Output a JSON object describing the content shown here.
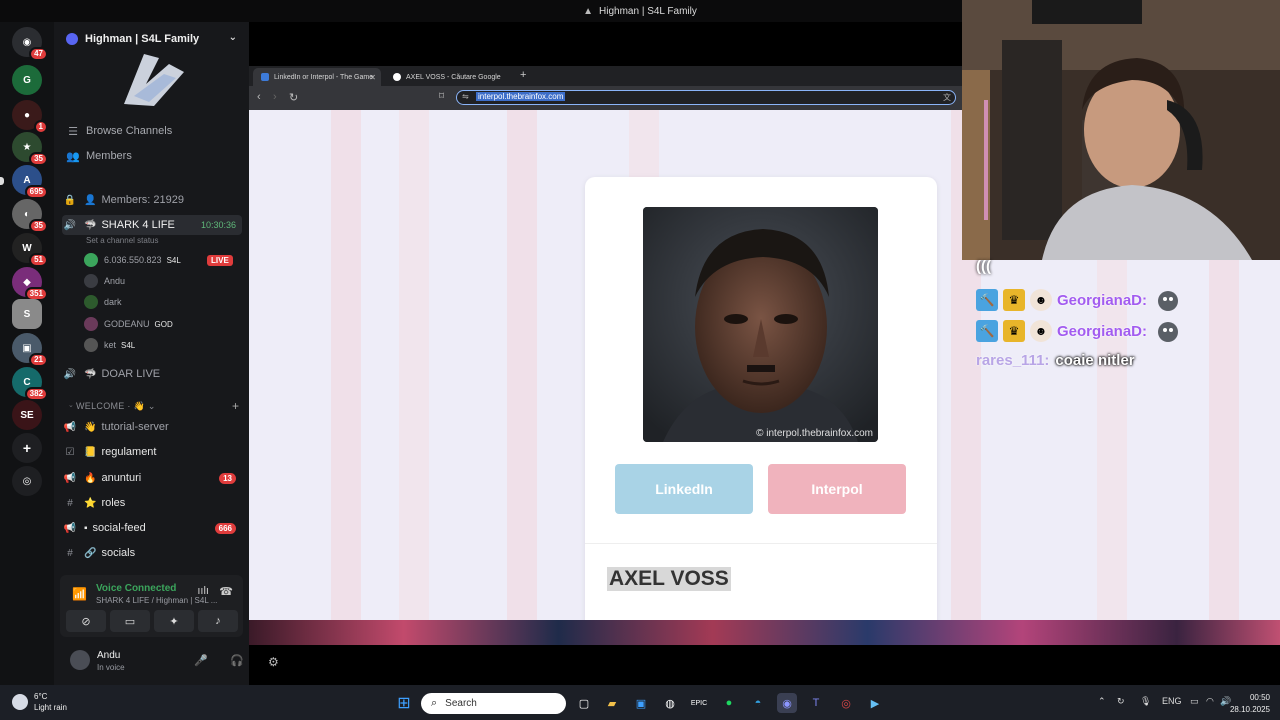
{
  "window": {
    "title": "Highman | S4L Family"
  },
  "discord": {
    "server_name": "Highman | S4L Family",
    "nav": [
      {
        "label": "Browse Channels",
        "icon": "list-icon"
      },
      {
        "label": "Members",
        "icon": "people-icon"
      }
    ],
    "members_channel": "Members: 21929",
    "active_voice": {
      "name": "SHARK 4 LIFE",
      "time": "10:30:36",
      "status": "Set a channel status"
    },
    "voice_users": [
      {
        "name": "6.036.550.823",
        "tag": "S4L",
        "live": "LIVE"
      },
      {
        "name": "Andu"
      },
      {
        "name": "dark"
      },
      {
        "name": "GODEANU",
        "tag": "GOD"
      },
      {
        "name": "ket",
        "tag": "S4L"
      }
    ],
    "doar_live": "DOAR LIVE",
    "category": "WELCOME",
    "channels": [
      {
        "name": "tutorial-server",
        "emoji": "👋",
        "badge": ""
      },
      {
        "name": "regulament",
        "emoji": "📒",
        "badge": ""
      },
      {
        "name": "anunturi",
        "emoji": "🔥",
        "badge": "13"
      },
      {
        "name": "roles",
        "emoji": "⭐",
        "badge": ""
      },
      {
        "name": "social-feed",
        "emoji": "▪",
        "badge": "666"
      },
      {
        "name": "socials",
        "emoji": "🔗",
        "badge": ""
      }
    ],
    "voice_connected": {
      "title": "Voice Connected",
      "sub": "SHARK 4 LIFE / Highman | S4L ..."
    },
    "user": {
      "name": "Andu",
      "status": "In voice"
    },
    "server_badges": [
      "47",
      "1",
      "35",
      "695",
      "35",
      "51",
      "351",
      "21",
      "382"
    ]
  },
  "browser": {
    "tabs": [
      {
        "label": "LinkedIn or Interpol - The Game",
        "active": true
      },
      {
        "label": "AXEL VOSS - Căutare Google",
        "active": false
      }
    ],
    "url": "interpol.thebrainfox.com"
  },
  "game": {
    "watermark": "© interpol.thebrainfox.com",
    "btn_linkedin": "LinkedIn",
    "btn_interpol": "Interpol",
    "person_name": "AXEL VOSS"
  },
  "chat": {
    "top_fragment": "(((",
    "messages": [
      {
        "user": "GeorgianaD:",
        "text": ""
      },
      {
        "user": "GeorgianaD:",
        "text": ""
      },
      {
        "user": "rares_111:",
        "text": "coaie nitler"
      }
    ]
  },
  "taskbar": {
    "weather_temp": "6°C",
    "weather_desc": "Light rain",
    "search_placeholder": "Search",
    "lang": "ENG",
    "time": "00:50",
    "date": "28.10.2025"
  },
  "colors": {
    "accent": "#5865f2",
    "online": "#3ba55c",
    "alert": "#e03c3c",
    "linkedin": "#a9d3e6",
    "interpol": "#f0b3bd"
  }
}
